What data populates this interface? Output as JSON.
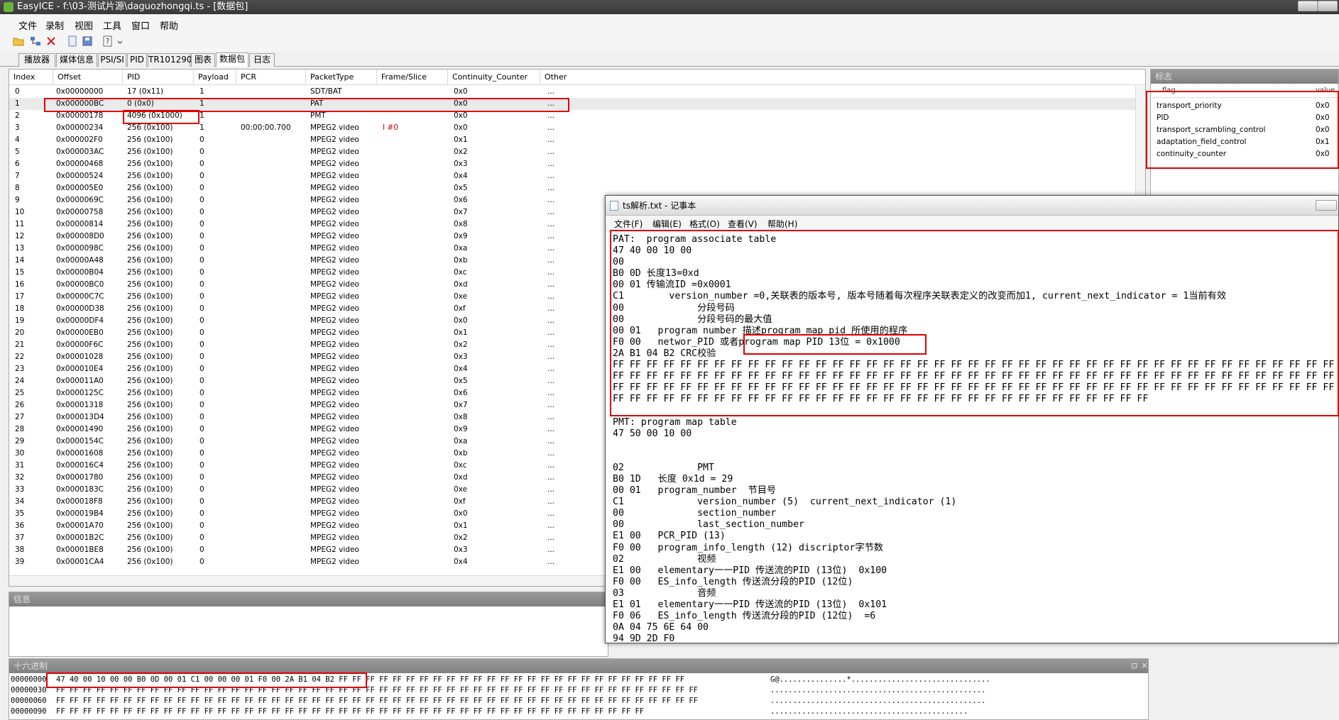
{
  "window": {
    "title": "EasyICE - f:\\03-测试片源\\daguozhongqi.ts - [数据包]"
  },
  "menu": [
    "文件",
    "录制",
    "视图",
    "工具",
    "窗口",
    "帮助"
  ],
  "toolbar_icons": [
    "open-folder-icon",
    "network-icon",
    "close-icon",
    "document-icon",
    "save-icon",
    "help-icon"
  ],
  "tabs": [
    "播放器",
    "媒体信息",
    "PSI/SI",
    "PID",
    "TR101290",
    "图表",
    "数据包",
    "日志"
  ],
  "active_tab": 6,
  "packets": {
    "columns": [
      "Index",
      "Offset",
      "PID",
      "Payload",
      "PCR",
      "PacketType",
      "Frame/Slice",
      "Continuity_Counter",
      "Other"
    ],
    "rows": [
      [
        "0",
        "0x00000000",
        "17   (0x11)",
        "1",
        "",
        "SDT/BAT",
        "",
        "0x0",
        "..."
      ],
      [
        "1",
        "0x000000BC",
        "0    (0x0)",
        "1",
        "",
        "PAT",
        "",
        "0x0",
        "..."
      ],
      [
        "2",
        "0x00000178",
        "4096   (0x1000)",
        "1",
        "",
        "PMT",
        "",
        "0x0",
        "..."
      ],
      [
        "3",
        "0x00000234",
        "256   (0x100)",
        "1",
        "00:00:00.700",
        "MPEG2 video",
        "I    #0",
        "0x0",
        "..."
      ],
      [
        "4",
        "0x000002F0",
        "256   (0x100)",
        "0",
        "",
        "MPEG2 video",
        "",
        "0x1",
        "..."
      ],
      [
        "5",
        "0x000003AC",
        "256   (0x100)",
        "0",
        "",
        "MPEG2 video",
        "",
        "0x2",
        "..."
      ],
      [
        "6",
        "0x00000468",
        "256   (0x100)",
        "0",
        "",
        "MPEG2 video",
        "",
        "0x3",
        "..."
      ],
      [
        "7",
        "0x00000524",
        "256   (0x100)",
        "0",
        "",
        "MPEG2 video",
        "",
        "0x4",
        "..."
      ],
      [
        "8",
        "0x000005E0",
        "256   (0x100)",
        "0",
        "",
        "MPEG2 video",
        "",
        "0x5",
        "..."
      ],
      [
        "9",
        "0x0000069C",
        "256   (0x100)",
        "0",
        "",
        "MPEG2 video",
        "",
        "0x6",
        "..."
      ],
      [
        "10",
        "0x00000758",
        "256   (0x100)",
        "0",
        "",
        "MPEG2 video",
        "",
        "0x7",
        "..."
      ],
      [
        "11",
        "0x00000814",
        "256   (0x100)",
        "0",
        "",
        "MPEG2 video",
        "",
        "0x8",
        "..."
      ],
      [
        "12",
        "0x000008D0",
        "256   (0x100)",
        "0",
        "",
        "MPEG2 video",
        "",
        "0x9",
        "..."
      ],
      [
        "13",
        "0x0000098C",
        "256   (0x100)",
        "0",
        "",
        "MPEG2 video",
        "",
        "0xa",
        "..."
      ],
      [
        "14",
        "0x00000A48",
        "256   (0x100)",
        "0",
        "",
        "MPEG2 video",
        "",
        "0xb",
        "..."
      ],
      [
        "15",
        "0x00000B04",
        "256   (0x100)",
        "0",
        "",
        "MPEG2 video",
        "",
        "0xc",
        "..."
      ],
      [
        "16",
        "0x00000BC0",
        "256   (0x100)",
        "0",
        "",
        "MPEG2 video",
        "",
        "0xd",
        "..."
      ],
      [
        "17",
        "0x00000C7C",
        "256   (0x100)",
        "0",
        "",
        "MPEG2 video",
        "",
        "0xe",
        "..."
      ],
      [
        "18",
        "0x00000D38",
        "256   (0x100)",
        "0",
        "",
        "MPEG2 video",
        "",
        "0xf",
        "..."
      ],
      [
        "19",
        "0x00000DF4",
        "256   (0x100)",
        "0",
        "",
        "MPEG2 video",
        "",
        "0x0",
        "..."
      ],
      [
        "20",
        "0x00000EB0",
        "256   (0x100)",
        "0",
        "",
        "MPEG2 video",
        "",
        "0x1",
        "..."
      ],
      [
        "21",
        "0x00000F6C",
        "256   (0x100)",
        "0",
        "",
        "MPEG2 video",
        "",
        "0x2",
        "..."
      ],
      [
        "22",
        "0x00001028",
        "256   (0x100)",
        "0",
        "",
        "MPEG2 video",
        "",
        "0x3",
        "..."
      ],
      [
        "23",
        "0x000010E4",
        "256   (0x100)",
        "0",
        "",
        "MPEG2 video",
        "",
        "0x4",
        "..."
      ],
      [
        "24",
        "0x000011A0",
        "256   (0x100)",
        "0",
        "",
        "MPEG2 video",
        "",
        "0x5",
        "..."
      ],
      [
        "25",
        "0x0000125C",
        "256   (0x100)",
        "0",
        "",
        "MPEG2 video",
        "",
        "0x6",
        "..."
      ],
      [
        "26",
        "0x00001318",
        "256   (0x100)",
        "0",
        "",
        "MPEG2 video",
        "",
        "0x7",
        "..."
      ],
      [
        "27",
        "0x000013D4",
        "256   (0x100)",
        "0",
        "",
        "MPEG2 video",
        "",
        "0x8",
        "..."
      ],
      [
        "28",
        "0x00001490",
        "256   (0x100)",
        "0",
        "",
        "MPEG2 video",
        "",
        "0x9",
        "..."
      ],
      [
        "29",
        "0x0000154C",
        "256   (0x100)",
        "0",
        "",
        "MPEG2 video",
        "",
        "0xa",
        "..."
      ],
      [
        "30",
        "0x00001608",
        "256   (0x100)",
        "0",
        "",
        "MPEG2 video",
        "",
        "0xb",
        "..."
      ],
      [
        "31",
        "0x000016C4",
        "256   (0x100)",
        "0",
        "",
        "MPEG2 video",
        "",
        "0xc",
        "..."
      ],
      [
        "32",
        "0x00001780",
        "256   (0x100)",
        "0",
        "",
        "MPEG2 video",
        "",
        "0xd",
        "..."
      ],
      [
        "33",
        "0x0000183C",
        "256   (0x100)",
        "0",
        "",
        "MPEG2 video",
        "",
        "0xe",
        "..."
      ],
      [
        "34",
        "0x000018F8",
        "256   (0x100)",
        "0",
        "",
        "MPEG2 video",
        "",
        "0xf",
        "..."
      ],
      [
        "35",
        "0x000019B4",
        "256   (0x100)",
        "0",
        "",
        "MPEG2 video",
        "",
        "0x0",
        "..."
      ],
      [
        "36",
        "0x00001A70",
        "256   (0x100)",
        "0",
        "",
        "MPEG2 video",
        "",
        "0x1",
        "..."
      ],
      [
        "37",
        "0x00001B2C",
        "256   (0x100)",
        "0",
        "",
        "MPEG2 video",
        "",
        "0x2",
        "..."
      ],
      [
        "38",
        "0x00001BE8",
        "256   (0x100)",
        "0",
        "",
        "MPEG2 video",
        "",
        "0x3",
        "..."
      ],
      [
        "39",
        "0x00001CA4",
        "256   (0x100)",
        "0",
        "",
        "MPEG2 video",
        "",
        "0x4",
        "..."
      ]
    ],
    "selected_row": 1
  },
  "flags": {
    "title": "标志",
    "col_flag": "flag",
    "col_value": "value",
    "rows": [
      [
        "transport_priority",
        "0x0"
      ],
      [
        "PID",
        "0x0"
      ],
      [
        "transport_scrambling_control",
        "0x0"
      ],
      [
        "adaptation_field_control",
        "0x1"
      ],
      [
        "continuity_counter",
        "0x0"
      ]
    ]
  },
  "info_panel": {
    "title": "信息"
  },
  "hex_panel": {
    "title": "十六进制",
    "lines": [
      {
        "offset": "00000000",
        "bytes": "47 40 00 10 00 00 B0 0D 00 01 C1 00 00 00 01 F0 00 2A B1 04 B2 FF FF FF FF FF FF FF FF FF FF FF FF FF FF FF FF FF FF FF FF FF FF FF FF FF FF",
        "ascii": "G@...............*..............................."
      },
      {
        "offset": "00000030",
        "bytes": "FF FF FF FF FF FF FF FF FF FF FF FF FF FF FF FF FF FF FF FF FF FF FF FF FF FF FF FF FF FF FF FF FF FF FF FF FF FF FF FF FF FF FF FF FF FF FF FF",
        "ascii": "................................................"
      },
      {
        "offset": "00000060",
        "bytes": "FF FF FF FF FF FF FF FF FF FF FF FF FF FF FF FF FF FF FF FF FF FF FF FF FF FF FF FF FF FF FF FF FF FF FF FF FF FF FF FF FF FF FF FF FF FF FF FF",
        "ascii": "................................................"
      },
      {
        "offset": "00000090",
        "bytes": "FF FF FF FF FF FF FF FF FF FF FF FF FF FF FF FF FF FF FF FF FF FF FF FF FF FF FF FF FF FF FF FF FF FF FF FF FF FF FF FF FF FF FF FF",
        "ascii": "............................................"
      }
    ]
  },
  "notepad": {
    "title": "ts解析.txt - 记事本",
    "menu": [
      "文件(F)",
      "编辑(E)",
      "格式(O)",
      "查看(V)",
      "帮助(H)"
    ],
    "lines": [
      "PAT:  program associate table",
      "47 40 00 10 00",
      "00",
      "B0 0D 长度13=0xd",
      "00 01 传输流ID =0x0001",
      "C1        version_number =0,关联表的版本号, 版本号随着每次程序关联表定义的改变而加1, current_next_indicator = 1当前有效",
      "00             分段号码",
      "00             分段号码的最大值",
      "00 01   program number 描述program map pid 所使用的程序",
      "F0 00   networ_PID 或者program map PID 13位 = 0x1000",
      "2A B1 04 B2 CRC校验",
      "FF FF FF FF FF FF FF FF FF FF FF FF FF FF FF FF FF FF FF FF FF FF FF FF FF FF FF FF FF FF FF FF FF FF FF FF FF FF FF FF FF FF FF FF FF FF FF FF FF FF FF FF FF",
      "FF FF FF FF FF FF FF FF FF FF FF FF FF FF FF FF FF FF FF FF FF FF FF FF FF FF FF FF FF FF FF FF FF FF FF FF FF FF FF FF FF FF FF FF FF FF FF FF FF FF FF FF FF",
      "FF FF FF FF FF FF FF FF FF FF FF FF FF FF FF FF FF FF FF FF FF FF FF FF FF FF FF FF FF FF FF FF FF FF FF FF FF FF FF FF FF FF FF FF FF FF FF FF FF FF FF FF FF",
      "FF FF FF FF FF FF FF FF FF FF FF FF FF FF FF FF FF FF FF FF FF FF FF FF FF FF FF FF FF FF FF FF",
      "",
      "PMT: program map table",
      "47 50 00 10 00",
      "",
      "",
      "02             PMT",
      "B0 1D   长度 0x1d = 29",
      "00 01   program_number  节目号",
      "C1             version_number (5)  current_next_indicator (1)",
      "00             section_number",
      "00             last_section_number",
      "E1 00   PCR_PID (13)",
      "F0 00   program_info_length (12) discriptor字节数",
      "02             视频",
      "E1 00   elementary一一PID 传送流的PID (13位)  0x100",
      "F0 00   ES_info_length 传送流分段的PID (12位)",
      "03             音频",
      "E1 01   elementary一一PID 传送流的PID (13位)  0x101",
      "F0 06   ES_info_length 传送流分段的PID (12位)  =6",
      "0A 04 75 6E 64 00",
      "94 9D 2D F0"
    ]
  }
}
